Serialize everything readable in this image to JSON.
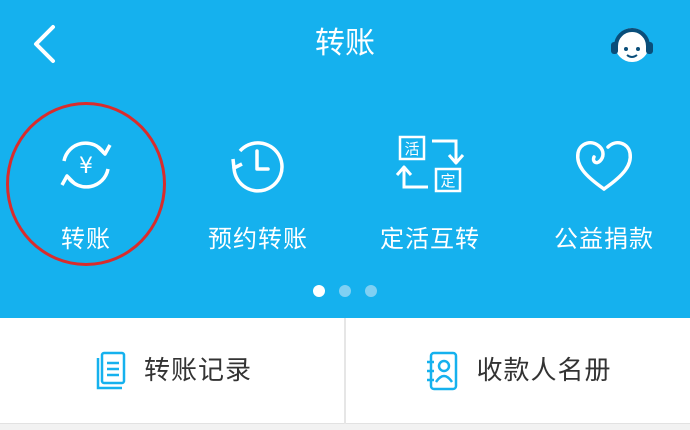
{
  "header": {
    "title": "转账",
    "back_icon": "chevron-left-icon",
    "service_icon": "customer-service-icon"
  },
  "features": [
    {
      "label": "转账",
      "icon": "yuan-exchange-icon"
    },
    {
      "label": "预约转账",
      "icon": "clock-icon"
    },
    {
      "label": "定活互转",
      "icon": "fixed-current-swap-icon"
    },
    {
      "label": "公益捐款",
      "icon": "heart-icon"
    }
  ],
  "pager": {
    "total": 3,
    "active": 1
  },
  "bottom": {
    "records_label": "转账记录",
    "records_icon": "document-icon",
    "payees_label": "收款人名册",
    "payees_icon": "contact-book-icon"
  },
  "colors": {
    "primary": "#15b1ee",
    "highlight": "#d92c2c",
    "text": "#333333"
  }
}
